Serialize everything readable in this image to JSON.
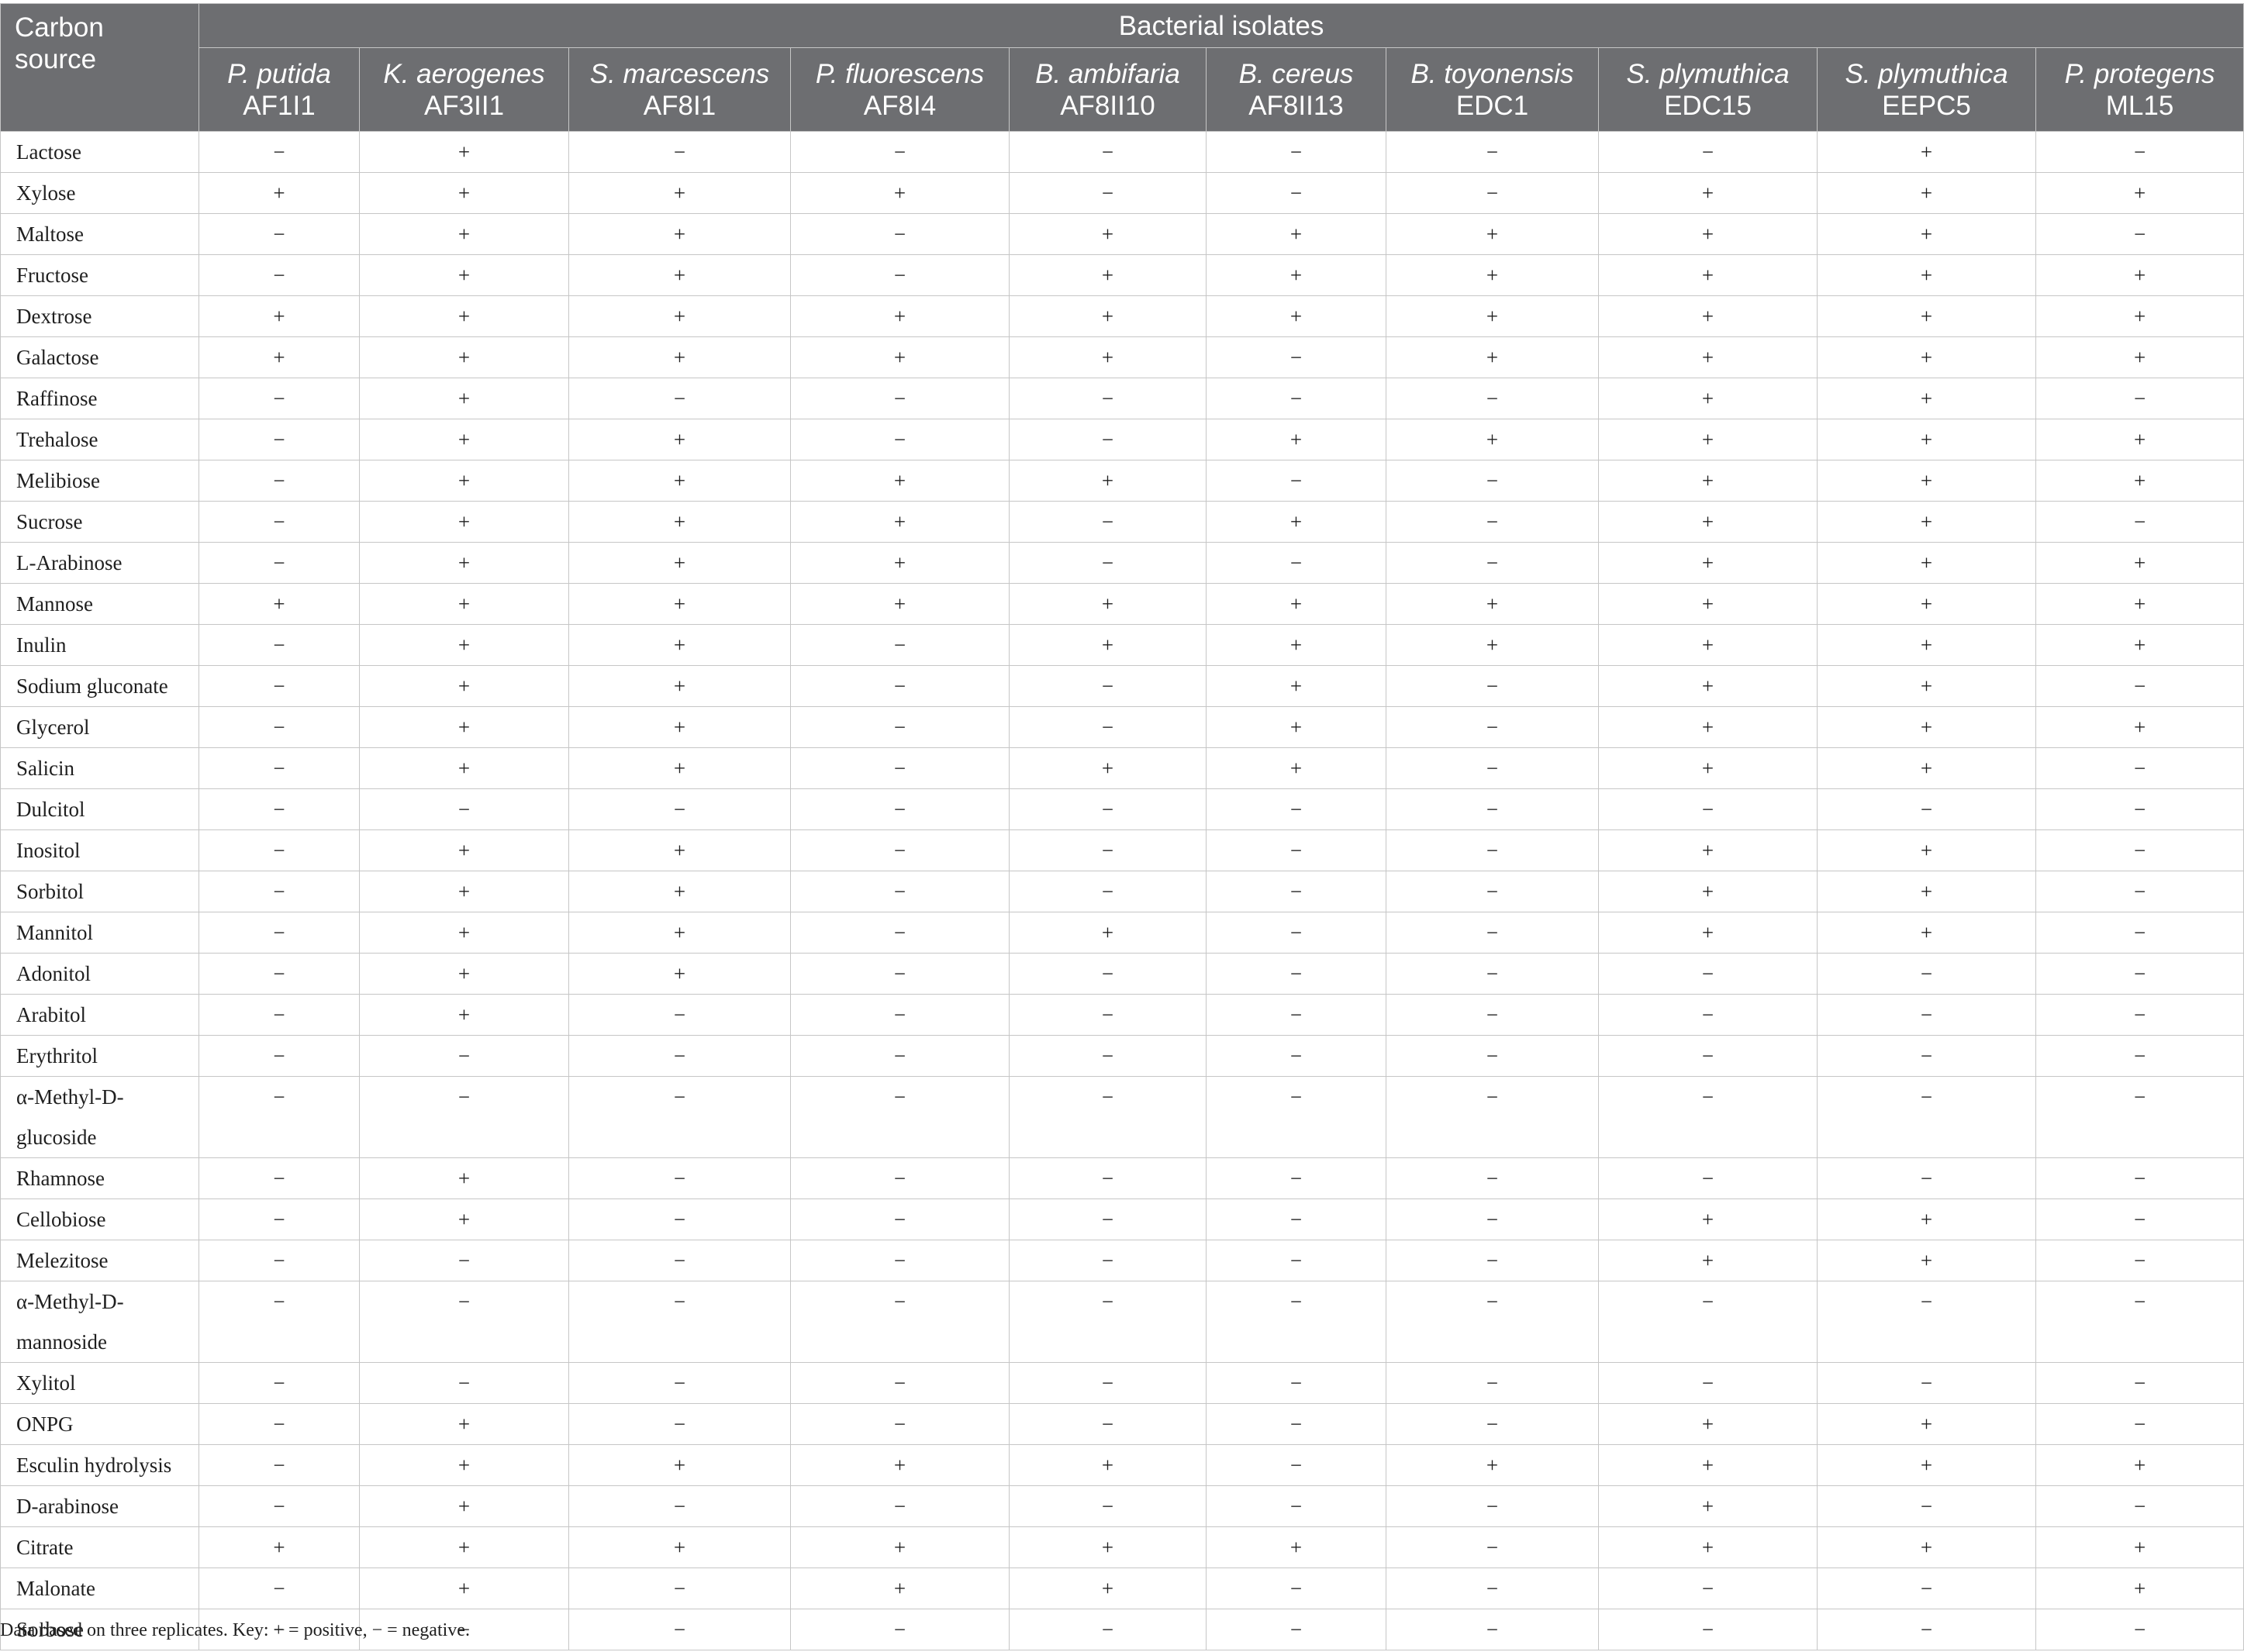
{
  "header": {
    "corner_label": "Carbon source",
    "group_label": "Bacterial isolates",
    "isolates": [
      {
        "species": "P. putida",
        "strain": "AF1I1"
      },
      {
        "species": "K. aerogenes",
        "strain": "AF3II1"
      },
      {
        "species": "S. marcescens",
        "strain": "AF8I1"
      },
      {
        "species": "P. fluorescens",
        "strain": "AF8I4"
      },
      {
        "species": "B. ambifaria",
        "strain": "AF8II10"
      },
      {
        "species": "B. cereus",
        "strain": "AF8II13"
      },
      {
        "species": "B. toyonensis",
        "strain": "EDC1"
      },
      {
        "species": "S. plymuthica",
        "strain": "EDC15"
      },
      {
        "species": "S. plymuthica",
        "strain": "EEPC5"
      },
      {
        "species": "P. protegens",
        "strain": "ML15"
      }
    ]
  },
  "rows": [
    {
      "source": "Lactose",
      "values": [
        "−",
        "+",
        "−",
        "−",
        "−",
        "−",
        "−",
        "−",
        "+",
        "−"
      ]
    },
    {
      "source": "Xylose",
      "values": [
        "+",
        "+",
        "+",
        "+",
        "−",
        "−",
        "−",
        "+",
        "+",
        "+"
      ]
    },
    {
      "source": "Maltose",
      "values": [
        "−",
        "+",
        "+",
        "−",
        "+",
        "+",
        "+",
        "+",
        "+",
        "−"
      ]
    },
    {
      "source": "Fructose",
      "values": [
        "−",
        "+",
        "+",
        "−",
        "+",
        "+",
        "+",
        "+",
        "+",
        "+"
      ]
    },
    {
      "source": "Dextrose",
      "values": [
        "+",
        "+",
        "+",
        "+",
        "+",
        "+",
        "+",
        "+",
        "+",
        "+"
      ]
    },
    {
      "source": "Galactose",
      "values": [
        "+",
        "+",
        "+",
        "+",
        "+",
        "−",
        "+",
        "+",
        "+",
        "+"
      ]
    },
    {
      "source": "Raffinose",
      "values": [
        "−",
        "+",
        "−",
        "−",
        "−",
        "−",
        "−",
        "+",
        "+",
        "−"
      ]
    },
    {
      "source": "Trehalose",
      "values": [
        "−",
        "+",
        "+",
        "−",
        "−",
        "+",
        "+",
        "+",
        "+",
        "+"
      ]
    },
    {
      "source": "Melibiose",
      "values": [
        "−",
        "+",
        "+",
        "+",
        "+",
        "−",
        "−",
        "+",
        "+",
        "+"
      ]
    },
    {
      "source": "Sucrose",
      "values": [
        "−",
        "+",
        "+",
        "+",
        "−",
        "+",
        "−",
        "+",
        "+",
        "−"
      ]
    },
    {
      "source": "L-Arabinose",
      "values": [
        "−",
        "+",
        "+",
        "+",
        "−",
        "−",
        "−",
        "+",
        "+",
        "+"
      ]
    },
    {
      "source": "Mannose",
      "values": [
        "+",
        "+",
        "+",
        "+",
        "+",
        "+",
        "+",
        "+",
        "+",
        "+"
      ]
    },
    {
      "source": "Inulin",
      "values": [
        "−",
        "+",
        "+",
        "−",
        "+",
        "+",
        "+",
        "+",
        "+",
        "+"
      ]
    },
    {
      "source": "Sodium gluconate",
      "values": [
        "−",
        "+",
        "+",
        "−",
        "−",
        "+",
        "−",
        "+",
        "+",
        "−"
      ]
    },
    {
      "source": "Glycerol",
      "values": [
        "−",
        "+",
        "+",
        "−",
        "−",
        "+",
        "−",
        "+",
        "+",
        "+"
      ]
    },
    {
      "source": "Salicin",
      "values": [
        "−",
        "+",
        "+",
        "−",
        "+",
        "+",
        "−",
        "+",
        "+",
        "−"
      ]
    },
    {
      "source": "Dulcitol",
      "values": [
        "−",
        "−",
        "−",
        "−",
        "−",
        "−",
        "−",
        "−",
        "−",
        "−"
      ]
    },
    {
      "source": "Inositol",
      "values": [
        "−",
        "+",
        "+",
        "−",
        "−",
        "−",
        "−",
        "+",
        "+",
        "−"
      ]
    },
    {
      "source": "Sorbitol",
      "values": [
        "−",
        "+",
        "+",
        "−",
        "−",
        "−",
        "−",
        "+",
        "+",
        "−"
      ]
    },
    {
      "source": "Mannitol",
      "values": [
        "−",
        "+",
        "+",
        "−",
        "+",
        "−",
        "−",
        "+",
        "+",
        "−"
      ]
    },
    {
      "source": "Adonitol",
      "values": [
        "−",
        "+",
        "+",
        "−",
        "−",
        "−",
        "−",
        "−",
        "−",
        "−"
      ]
    },
    {
      "source": "Arabitol",
      "values": [
        "−",
        "+",
        "−",
        "−",
        "−",
        "−",
        "−",
        "−",
        "−",
        "−"
      ]
    },
    {
      "source": "Erythritol",
      "values": [
        "−",
        "−",
        "−",
        "−",
        "−",
        "−",
        "−",
        "−",
        "−",
        "−"
      ]
    },
    {
      "source": "α-Methyl-D-glucoside",
      "values": [
        "−",
        "−",
        "−",
        "−",
        "−",
        "−",
        "−",
        "−",
        "−",
        "−"
      ],
      "tall": true
    },
    {
      "source": "Rhamnose",
      "values": [
        "−",
        "+",
        "−",
        "−",
        "−",
        "−",
        "−",
        "−",
        "−",
        "−"
      ]
    },
    {
      "source": "Cellobiose",
      "values": [
        "−",
        "+",
        "−",
        "−",
        "−",
        "−",
        "−",
        "+",
        "+",
        "−"
      ]
    },
    {
      "source": "Melezitose",
      "values": [
        "−",
        "−",
        "−",
        "−",
        "−",
        "−",
        "−",
        "+",
        "+",
        "−"
      ]
    },
    {
      "source": "α-Methyl-D-mannoside",
      "values": [
        "−",
        "−",
        "−",
        "−",
        "−",
        "−",
        "−",
        "−",
        "−",
        "−"
      ],
      "tall": true
    },
    {
      "source": "Xylitol",
      "values": [
        "−",
        "−",
        "−",
        "−",
        "−",
        "−",
        "−",
        "−",
        "−",
        "−"
      ]
    },
    {
      "source": "ONPG",
      "values": [
        "−",
        "+",
        "−",
        "−",
        "−",
        "−",
        "−",
        "+",
        "+",
        "−"
      ]
    },
    {
      "source": "Esculin hydrolysis",
      "values": [
        "−",
        "+",
        "+",
        "+",
        "+",
        "−",
        "+",
        "+",
        "+",
        "+"
      ]
    },
    {
      "source": "D-arabinose",
      "values": [
        "−",
        "+",
        "−",
        "−",
        "−",
        "−",
        "−",
        "+",
        "−",
        "−"
      ]
    },
    {
      "source": "Citrate",
      "values": [
        "+",
        "+",
        "+",
        "+",
        "+",
        "+",
        "−",
        "+",
        "+",
        "+"
      ]
    },
    {
      "source": "Malonate",
      "values": [
        "−",
        "+",
        "−",
        "+",
        "+",
        "−",
        "−",
        "−",
        "−",
        "+"
      ]
    },
    {
      "source": "Sorbose",
      "values": [
        "−",
        "−",
        "−",
        "−",
        "−",
        "−",
        "−",
        "−",
        "−",
        "−"
      ]
    }
  ],
  "footnote": "Data based on three replicates. Key: + = positive, − = negative."
}
